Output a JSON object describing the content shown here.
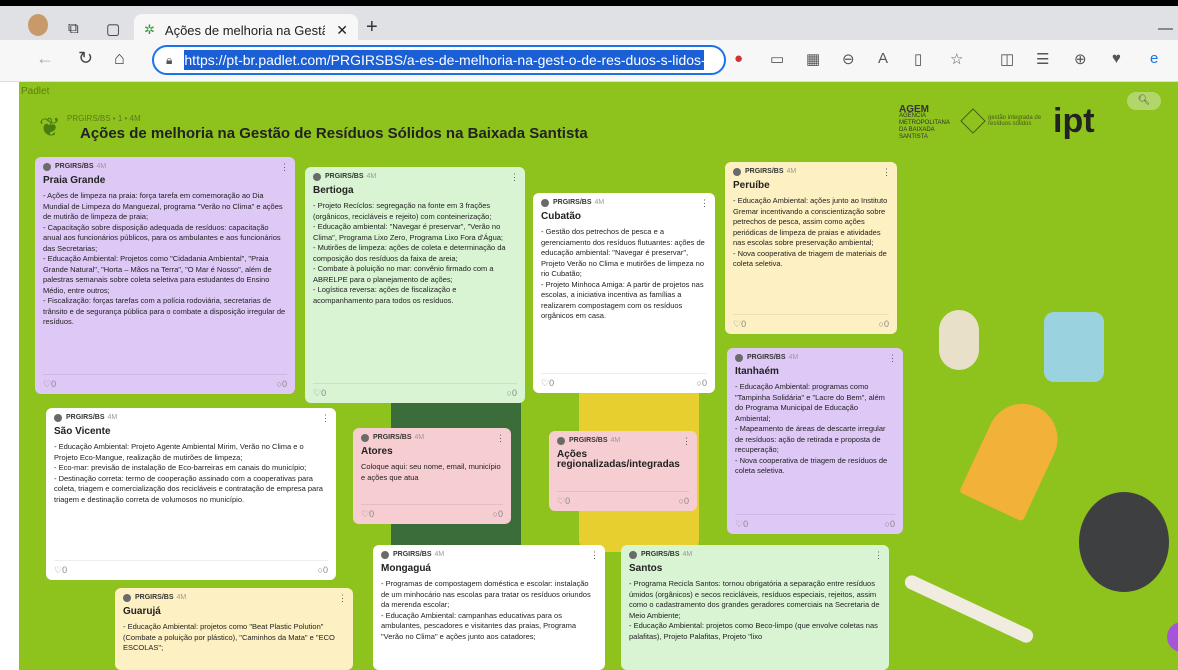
{
  "browser": {
    "tab_title": "Ações de melhoria na Gestão de",
    "url": "https://pt-br.padlet.com/PRGIRSBS/a-es-de-melhoria-na-gest-o-de-res-duos-s-lidos-na-baixa",
    "icons": [
      "avatar",
      "collections-icon",
      "tab-actions-icon",
      "padlet-icon",
      "close-icon",
      "new-tab-icon",
      "back-icon",
      "refresh-icon",
      "home-icon",
      "lock-icon"
    ]
  },
  "padlet": {
    "brand": "Padlet",
    "breadcrumb": "PRGIRS/BS • 1 • 4M",
    "title": "Ações de melhoria na Gestão de Resíduos Sólidos na Baixada Santista",
    "agem_title": "AGEM",
    "agem_sub": "AGÊNCIA METROPOLITANA DA BAIXADA SANTISTA",
    "gi_text": "gestão integrada de resíduos sólidos",
    "ipt": "ipt"
  },
  "cards": [
    {
      "key": "praia",
      "author": "PRGIRS/BS",
      "time": "4M",
      "title": "Praia Grande",
      "body": "- Ações de limpeza na praia: força tarefa em comemoração ao Dia Mundial de Limpeza do Manguezal, programa \"Verão no Clima\" e ações de mutirão de limpeza de praia;\n- Capacitação sobre disposição adequada de resíduos: capacitação anual aos funcionários públicos, para os ambulantes e aos funcionários das Secretarias;\n- Educação Ambiental: Projetos como \"Cidadania Ambiental\", \"Praia Grande Natural\", \"Horta – Mãos na Terra\", \"O Mar é Nosso\", além de palestras semanais sobre coleta seletiva para estudantes do Ensino Médio, entre outros;\n- Fiscalização: forças tarefas com a polícia rodoviária, secretarias de trânsito e de segurança pública para o combate a disposição irregular de resíduos."
    },
    {
      "key": "bertioga",
      "author": "PRGIRS/BS",
      "time": "4M",
      "title": "Bertioga",
      "body": "- Projeto Recíclos: segregação na fonte em 3 frações (orgânicos, recicláveis e rejeito) com conteinerização;\n- Educação ambiental: \"Navegar é preservar\", \"Verão no Clima\", Programa Lixo Zero, Programa Lixo Fora d'Água;\n- Mutirões de limpeza: ações de coleta e determinação da composição dos resíduos da faixa de areia;\n- Combate à poluição no mar: convênio firmado com a ABRELPE para o planejamento de ações;\n- Logística reversa: ações de fiscalização e acompanhamento para todos os resíduos."
    },
    {
      "key": "cubatao",
      "author": "PRGIRS/BS",
      "time": "4M",
      "title": "Cubatão",
      "body": "- Gestão dos petrechos de pesca e a gerenciamento dos resíduos flutuantes: ações de educação ambiental: \"Navegar é preservar\", Projeto Verão no Clima e mutirões de limpeza no rio Cubatão;\n- Projeto Minhoca Amiga: A partir de projetos nas escolas, a iniciativa incentiva as famílias a realizarem compostagem com os resíduos orgânicos em casa."
    },
    {
      "key": "peruibe",
      "author": "PRGIRS/BS",
      "time": "4M",
      "title": "Peruíbe",
      "body": "- Educação Ambiental: ações junto ao Instituto Gremar incentivando a conscientização sobre petrechos de pesca, assim como ações periódicas de limpeza de praias e atividades nas escolas sobre preservação ambiental;\n- Nova cooperativa de triagem de materiais de coleta seletiva."
    },
    {
      "key": "itanhaem",
      "author": "PRGIRS/BS",
      "time": "4M",
      "title": "Itanhaém",
      "body": "- Educação Ambiental: programas como \"Tampinha Solidária\" e \"Lacre do Bem\", além do Programa Municipal de Educação Ambiental;\n- Mapeamento de áreas de descarte irregular de resíduos: ação de retirada e proposta de recuperação;\n- Nova cooperativa de triagem de resíduos de coleta seletiva."
    },
    {
      "key": "saovicente",
      "author": "PRGIRS/BS",
      "time": "4M",
      "title": "São Vicente",
      "body": "- Educação Ambiental: Projeto Agente Ambiental Mirim, Verão no Clima e o Projeto Eco-Mangue, realização de mutirões de limpeza;\n- Eco-mar: previsão de instalação de Eco-barreiras em canais do município;\n- Destinação correta: termo de cooperação assinado com a cooperativas para coleta, triagem e comercialização dos recicláveis e contratação de empresa para triagem e destinação correta de volumosos no município."
    },
    {
      "key": "atores",
      "author": "PRGIRS/BS",
      "time": "4M",
      "title": "Atores",
      "body": "Coloque aqui: seu nome, email, município e ações que atua"
    },
    {
      "key": "acoes",
      "author": "PRGIRS/BS",
      "time": "4M",
      "title": "Ações regionalizadas/integradas",
      "body": ""
    },
    {
      "key": "mongagua",
      "author": "PRGIRS/BS",
      "time": "4M",
      "title": "Mongaguá",
      "body": "- Programas de compostagem doméstica e escolar: instalação de um minhocário nas escolas para tratar os resíduos oriundos da merenda escolar;\n- Educação Ambiental: campanhas educativas para os ambulantes, pescadores e visitantes das praias, Programa \"Verão no Clima\" e ações junto aos catadores;"
    },
    {
      "key": "santos",
      "author": "PRGIRS/BS",
      "time": "4M",
      "title": "Santos",
      "body": "- Programa Recicla Santos: tornou obrigatória a separação entre resíduos úmidos (orgânicos) e secos recicláveis, resíduos especiais, rejeitos, assim como o cadastramento dos grandes geradores comerciais na Secretaria de Meio Ambiente;\n- Educação Ambiental: projetos como Beco-limpo (que envolve coletas nas palafitas), Projeto Palafitas, Projeto \"lixo"
    },
    {
      "key": "guaruja",
      "author": "PRGIRS/BS",
      "time": "4M",
      "title": "Guarujá",
      "body": "- Educação Ambiental: projetos como \"Beat Plastic Polution\" (Combate a poluição por plástico), \"Caminhos da Mata\" e \"ECO ESCOLAS\";"
    }
  ],
  "likes": "0",
  "comments": "0"
}
